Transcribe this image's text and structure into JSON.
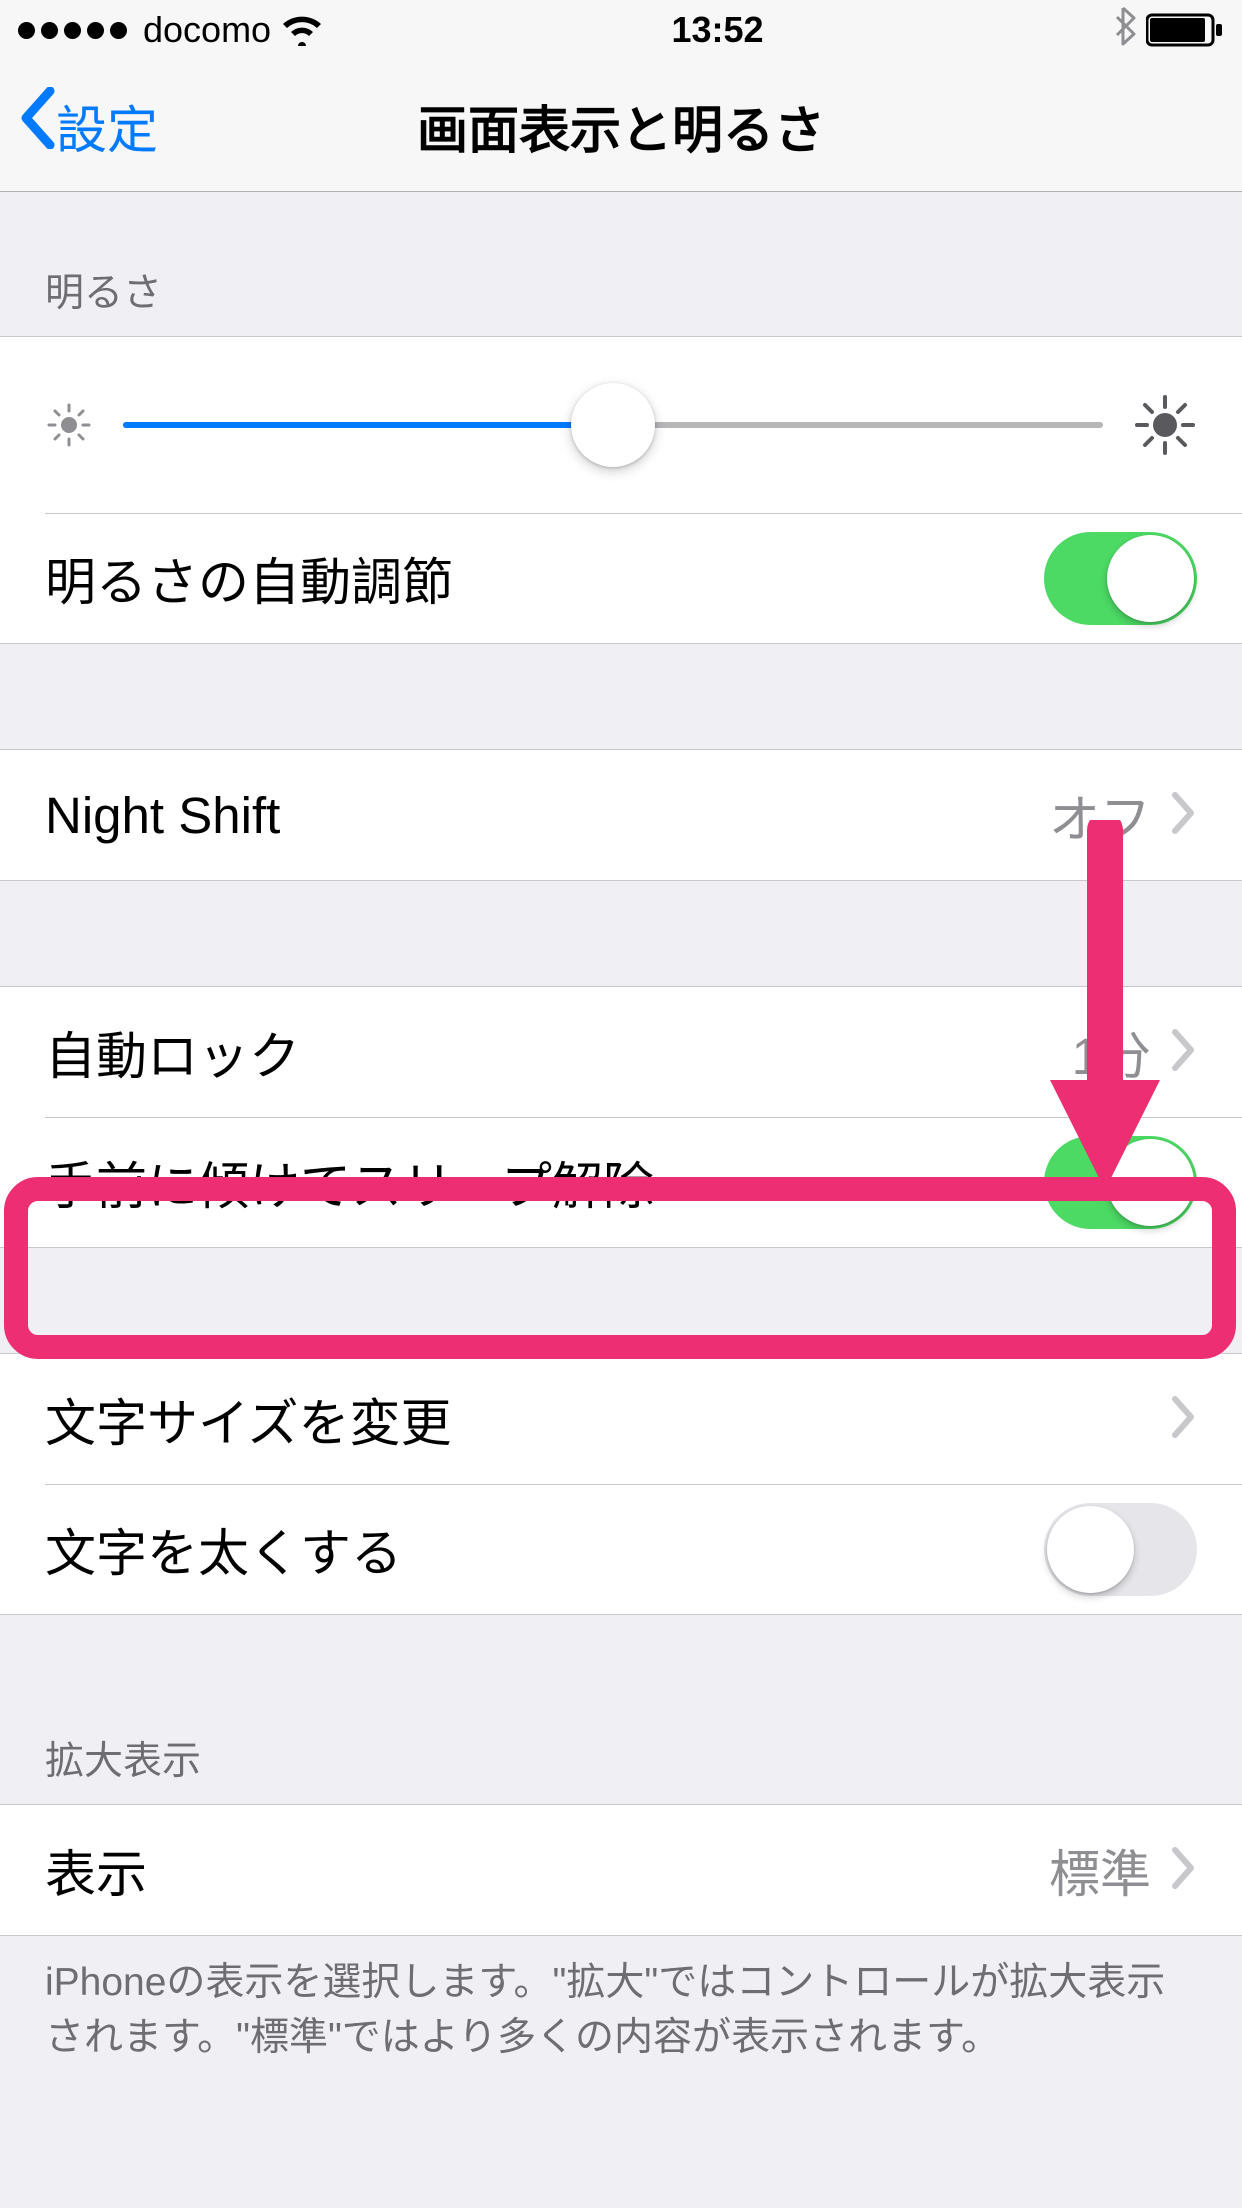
{
  "status_bar": {
    "carrier": "docomo",
    "time": "13:52"
  },
  "nav": {
    "back_label": "設定",
    "title": "画面表示と明るさ"
  },
  "sections": {
    "brightness_header": "明るさ",
    "auto_brightness_label": "明るさの自動調節",
    "night_shift_label": "Night Shift",
    "night_shift_value": "オフ",
    "auto_lock_label": "自動ロック",
    "auto_lock_value": "1分",
    "raise_to_wake_label": "手前に傾けてスリープ解除",
    "text_size_label": "文字サイズを変更",
    "bold_text_label": "文字を太くする",
    "zoom_header": "拡大表示",
    "view_label": "表示",
    "view_value": "標準",
    "zoom_footer": "iPhoneの表示を選択します。\"拡大\"ではコントロールが拡大表示されます。\"標準\"ではより多くの内容が表示されます。"
  },
  "toggles": {
    "auto_brightness": true,
    "raise_to_wake": true,
    "bold_text": false
  },
  "slider": {
    "brightness_percent": 50
  }
}
